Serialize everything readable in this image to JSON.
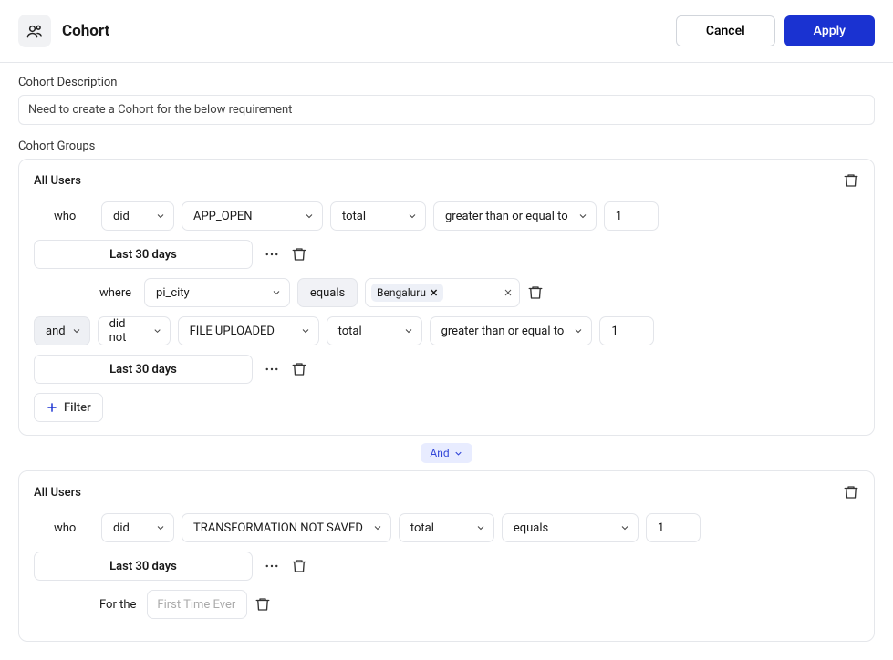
{
  "header": {
    "title": "Cohort",
    "cancel_label": "Cancel",
    "apply_label": "Apply"
  },
  "description": {
    "label": "Cohort Description",
    "value": "Need to create a Cohort for the below requirement"
  },
  "groups_label": "Cohort Groups",
  "connectors": {
    "between_groups": "And"
  },
  "groups": [
    {
      "title": "All Users",
      "rules": [
        {
          "who_label": "who",
          "verb": "did",
          "event": "APP_OPEN",
          "measure": "total",
          "operator": "greater than or equal to",
          "value": "1",
          "timeframe": "Last 30 days",
          "filter": {
            "where_label": "where",
            "property": "pi_city",
            "op": "equals",
            "chip": "Bengaluru"
          }
        },
        {
          "connector": "and",
          "verb": "did not",
          "event": "FILE UPLOADED",
          "measure": "total",
          "operator": "greater than or equal to",
          "value": "1",
          "timeframe": "Last 30 days"
        }
      ],
      "add_filter_label": "Filter"
    },
    {
      "title": "All Users",
      "rules": [
        {
          "who_label": "who",
          "verb": "did",
          "event": "TRANSFORMATION NOT SAVED",
          "measure": "total",
          "operator": "equals",
          "value": "1",
          "timeframe": "Last 30 days",
          "forthe": {
            "label": "For the",
            "placeholder": "First Time Ever"
          }
        }
      ]
    }
  ]
}
